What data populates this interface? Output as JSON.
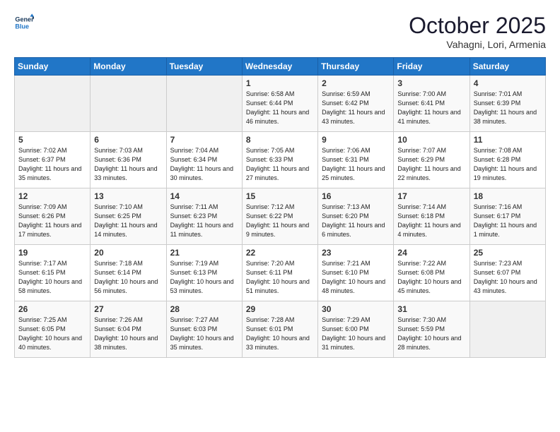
{
  "header": {
    "logo_line1": "General",
    "logo_line2": "Blue",
    "month": "October 2025",
    "location": "Vahagni, Lori, Armenia"
  },
  "days_of_week": [
    "Sunday",
    "Monday",
    "Tuesday",
    "Wednesday",
    "Thursday",
    "Friday",
    "Saturday"
  ],
  "weeks": [
    [
      {
        "day": "",
        "sunrise": "",
        "sunset": "",
        "daylight": ""
      },
      {
        "day": "",
        "sunrise": "",
        "sunset": "",
        "daylight": ""
      },
      {
        "day": "",
        "sunrise": "",
        "sunset": "",
        "daylight": ""
      },
      {
        "day": "1",
        "sunrise": "Sunrise: 6:58 AM",
        "sunset": "Sunset: 6:44 PM",
        "daylight": "Daylight: 11 hours and 46 minutes."
      },
      {
        "day": "2",
        "sunrise": "Sunrise: 6:59 AM",
        "sunset": "Sunset: 6:42 PM",
        "daylight": "Daylight: 11 hours and 43 minutes."
      },
      {
        "day": "3",
        "sunrise": "Sunrise: 7:00 AM",
        "sunset": "Sunset: 6:41 PM",
        "daylight": "Daylight: 11 hours and 41 minutes."
      },
      {
        "day": "4",
        "sunrise": "Sunrise: 7:01 AM",
        "sunset": "Sunset: 6:39 PM",
        "daylight": "Daylight: 11 hours and 38 minutes."
      }
    ],
    [
      {
        "day": "5",
        "sunrise": "Sunrise: 7:02 AM",
        "sunset": "Sunset: 6:37 PM",
        "daylight": "Daylight: 11 hours and 35 minutes."
      },
      {
        "day": "6",
        "sunrise": "Sunrise: 7:03 AM",
        "sunset": "Sunset: 6:36 PM",
        "daylight": "Daylight: 11 hours and 33 minutes."
      },
      {
        "day": "7",
        "sunrise": "Sunrise: 7:04 AM",
        "sunset": "Sunset: 6:34 PM",
        "daylight": "Daylight: 11 hours and 30 minutes."
      },
      {
        "day": "8",
        "sunrise": "Sunrise: 7:05 AM",
        "sunset": "Sunset: 6:33 PM",
        "daylight": "Daylight: 11 hours and 27 minutes."
      },
      {
        "day": "9",
        "sunrise": "Sunrise: 7:06 AM",
        "sunset": "Sunset: 6:31 PM",
        "daylight": "Daylight: 11 hours and 25 minutes."
      },
      {
        "day": "10",
        "sunrise": "Sunrise: 7:07 AM",
        "sunset": "Sunset: 6:29 PM",
        "daylight": "Daylight: 11 hours and 22 minutes."
      },
      {
        "day": "11",
        "sunrise": "Sunrise: 7:08 AM",
        "sunset": "Sunset: 6:28 PM",
        "daylight": "Daylight: 11 hours and 19 minutes."
      }
    ],
    [
      {
        "day": "12",
        "sunrise": "Sunrise: 7:09 AM",
        "sunset": "Sunset: 6:26 PM",
        "daylight": "Daylight: 11 hours and 17 minutes."
      },
      {
        "day": "13",
        "sunrise": "Sunrise: 7:10 AM",
        "sunset": "Sunset: 6:25 PM",
        "daylight": "Daylight: 11 hours and 14 minutes."
      },
      {
        "day": "14",
        "sunrise": "Sunrise: 7:11 AM",
        "sunset": "Sunset: 6:23 PM",
        "daylight": "Daylight: 11 hours and 11 minutes."
      },
      {
        "day": "15",
        "sunrise": "Sunrise: 7:12 AM",
        "sunset": "Sunset: 6:22 PM",
        "daylight": "Daylight: 11 hours and 9 minutes."
      },
      {
        "day": "16",
        "sunrise": "Sunrise: 7:13 AM",
        "sunset": "Sunset: 6:20 PM",
        "daylight": "Daylight: 11 hours and 6 minutes."
      },
      {
        "day": "17",
        "sunrise": "Sunrise: 7:14 AM",
        "sunset": "Sunset: 6:18 PM",
        "daylight": "Daylight: 11 hours and 4 minutes."
      },
      {
        "day": "18",
        "sunrise": "Sunrise: 7:16 AM",
        "sunset": "Sunset: 6:17 PM",
        "daylight": "Daylight: 11 hours and 1 minute."
      }
    ],
    [
      {
        "day": "19",
        "sunrise": "Sunrise: 7:17 AM",
        "sunset": "Sunset: 6:15 PM",
        "daylight": "Daylight: 10 hours and 58 minutes."
      },
      {
        "day": "20",
        "sunrise": "Sunrise: 7:18 AM",
        "sunset": "Sunset: 6:14 PM",
        "daylight": "Daylight: 10 hours and 56 minutes."
      },
      {
        "day": "21",
        "sunrise": "Sunrise: 7:19 AM",
        "sunset": "Sunset: 6:13 PM",
        "daylight": "Daylight: 10 hours and 53 minutes."
      },
      {
        "day": "22",
        "sunrise": "Sunrise: 7:20 AM",
        "sunset": "Sunset: 6:11 PM",
        "daylight": "Daylight: 10 hours and 51 minutes."
      },
      {
        "day": "23",
        "sunrise": "Sunrise: 7:21 AM",
        "sunset": "Sunset: 6:10 PM",
        "daylight": "Daylight: 10 hours and 48 minutes."
      },
      {
        "day": "24",
        "sunrise": "Sunrise: 7:22 AM",
        "sunset": "Sunset: 6:08 PM",
        "daylight": "Daylight: 10 hours and 45 minutes."
      },
      {
        "day": "25",
        "sunrise": "Sunrise: 7:23 AM",
        "sunset": "Sunset: 6:07 PM",
        "daylight": "Daylight: 10 hours and 43 minutes."
      }
    ],
    [
      {
        "day": "26",
        "sunrise": "Sunrise: 7:25 AM",
        "sunset": "Sunset: 6:05 PM",
        "daylight": "Daylight: 10 hours and 40 minutes."
      },
      {
        "day": "27",
        "sunrise": "Sunrise: 7:26 AM",
        "sunset": "Sunset: 6:04 PM",
        "daylight": "Daylight: 10 hours and 38 minutes."
      },
      {
        "day": "28",
        "sunrise": "Sunrise: 7:27 AM",
        "sunset": "Sunset: 6:03 PM",
        "daylight": "Daylight: 10 hours and 35 minutes."
      },
      {
        "day": "29",
        "sunrise": "Sunrise: 7:28 AM",
        "sunset": "Sunset: 6:01 PM",
        "daylight": "Daylight: 10 hours and 33 minutes."
      },
      {
        "day": "30",
        "sunrise": "Sunrise: 7:29 AM",
        "sunset": "Sunset: 6:00 PM",
        "daylight": "Daylight: 10 hours and 31 minutes."
      },
      {
        "day": "31",
        "sunrise": "Sunrise: 7:30 AM",
        "sunset": "Sunset: 5:59 PM",
        "daylight": "Daylight: 10 hours and 28 minutes."
      },
      {
        "day": "",
        "sunrise": "",
        "sunset": "",
        "daylight": ""
      }
    ]
  ]
}
